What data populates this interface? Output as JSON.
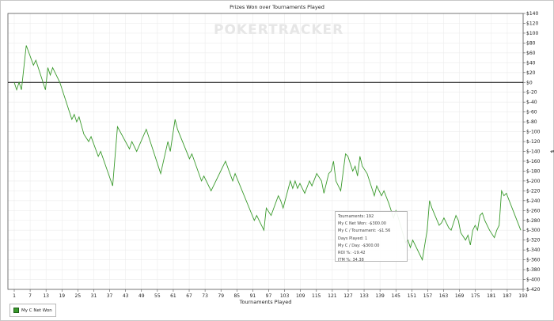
{
  "chart_data": {
    "type": "line",
    "title": "Prizes Won over Tournaments Played",
    "xlabel": "Tournaments Played",
    "ylabel": "$",
    "xlim": [
      1,
      193
    ],
    "ylim": [
      -420,
      140
    ],
    "x_ticks": [
      "1",
      "7",
      "13",
      "19",
      "25",
      "31",
      "37",
      "43",
      "49",
      "55",
      "61",
      "67",
      "73",
      "79",
      "85",
      "91",
      "97",
      "103",
      "109",
      "115",
      "121",
      "127",
      "133",
      "139",
      "145",
      "151",
      "157",
      "163",
      "169",
      "175",
      "181",
      "187",
      "193"
    ],
    "y_ticks": [
      "$140",
      "$120",
      "$100",
      "$80",
      "$60",
      "$40",
      "$20",
      "$0",
      "$-20",
      "$-40",
      "$-60",
      "$-80",
      "$-100",
      "$-120",
      "$-140",
      "$-160",
      "$-180",
      "$-200",
      "$-220",
      "$-240",
      "$-260",
      "$-280",
      "$-300",
      "$-320",
      "$-340",
      "$-360",
      "$-380",
      "$-400",
      "$-420"
    ],
    "grid": true,
    "legend_position": "bottom-left",
    "series": [
      {
        "name": "My C Net Won",
        "color": "#3a9a2c",
        "points": [
          [
            1,
            0
          ],
          [
            2,
            -15
          ],
          [
            3,
            0
          ],
          [
            4,
            -15
          ],
          [
            6,
            75
          ],
          [
            9,
            35
          ],
          [
            10,
            45
          ],
          [
            14,
            -15
          ],
          [
            15,
            30
          ],
          [
            16,
            15
          ],
          [
            17,
            30
          ],
          [
            20,
            0
          ],
          [
            25,
            -75
          ],
          [
            26,
            -65
          ],
          [
            27,
            -80
          ],
          [
            28,
            -70
          ],
          [
            30,
            -105
          ],
          [
            32,
            -120
          ],
          [
            33,
            -110
          ],
          [
            36,
            -150
          ],
          [
            37,
            -140
          ],
          [
            42,
            -210
          ],
          [
            44,
            -90
          ],
          [
            49,
            -135
          ],
          [
            50,
            -120
          ],
          [
            52,
            -140
          ],
          [
            56,
            -95
          ],
          [
            62,
            -185
          ],
          [
            65,
            -120
          ],
          [
            66,
            -140
          ],
          [
            68,
            -75
          ],
          [
            69,
            -95
          ],
          [
            74,
            -155
          ],
          [
            75,
            -145
          ],
          [
            79,
            -200
          ],
          [
            80,
            -190
          ],
          [
            83,
            -220
          ],
          [
            89,
            -160
          ],
          [
            92,
            -200
          ],
          [
            93,
            -185
          ],
          [
            101,
            -280
          ],
          [
            102,
            -270
          ],
          [
            105,
            -300
          ],
          [
            106,
            -255
          ],
          [
            108,
            -270
          ],
          [
            111,
            -230
          ],
          [
            112,
            -240
          ],
          [
            113,
            -255
          ],
          [
            116,
            -200
          ],
          [
            117,
            -215
          ],
          [
            118,
            -200
          ],
          [
            119,
            -215
          ],
          [
            120,
            -205
          ],
          [
            122,
            -225
          ],
          [
            124,
            -200
          ],
          [
            125,
            -210
          ],
          [
            127,
            -185
          ],
          [
            129,
            -200
          ],
          [
            130,
            -225
          ],
          [
            131,
            -205
          ],
          [
            132,
            -185
          ],
          [
            133,
            -180
          ],
          [
            134,
            -160
          ],
          [
            135,
            -200
          ],
          [
            137,
            -220
          ],
          [
            139,
            -145
          ],
          [
            140,
            -150
          ],
          [
            142,
            -180
          ],
          [
            143,
            -170
          ],
          [
            144,
            -190
          ],
          [
            145,
            -150
          ],
          [
            146,
            -170
          ],
          [
            148,
            -185
          ],
          [
            151,
            -230
          ],
          [
            152,
            -210
          ],
          [
            154,
            -230
          ],
          [
            155,
            -220
          ],
          [
            157,
            -245
          ],
          [
            158,
            -260
          ],
          [
            159,
            -275
          ],
          [
            160,
            -260
          ],
          [
            161,
            -275
          ],
          [
            164,
            -325
          ],
          [
            165,
            -320
          ],
          [
            166,
            -335
          ],
          [
            167,
            -320
          ],
          [
            170,
            -350
          ],
          [
            171,
            -360
          ],
          [
            173,
            -300
          ],
          [
            174,
            -240
          ],
          [
            175,
            -255
          ],
          [
            178,
            -290
          ],
          [
            179,
            -285
          ],
          [
            180,
            -275
          ],
          [
            182,
            -295
          ],
          [
            183,
            -300
          ],
          [
            185,
            -270
          ],
          [
            186,
            -280
          ],
          [
            187,
            -305
          ],
          [
            189,
            -320
          ],
          [
            190,
            -310
          ],
          [
            191,
            -330
          ],
          [
            192,
            -300
          ],
          [
            193,
            -290
          ],
          [
            194,
            -300
          ],
          [
            195,
            -270
          ],
          [
            196,
            -265
          ],
          [
            197,
            -280
          ],
          [
            199,
            -300
          ],
          [
            201,
            -315
          ],
          [
            202,
            -300
          ],
          [
            203,
            -290
          ],
          [
            204,
            -220
          ],
          [
            205,
            -230
          ],
          [
            206,
            -225
          ],
          [
            212,
            -300
          ]
        ]
      }
    ],
    "tooltip": [
      "Tournaments: 192",
      "My C Net Won: -$300.00",
      "My C / Tournament: -$1.56",
      "Days Played: 1",
      "My C / Day: -$300.00",
      "ROI %: -19.42",
      "ITM %: 34.38"
    ],
    "watermark": "POKERTRACKER"
  }
}
